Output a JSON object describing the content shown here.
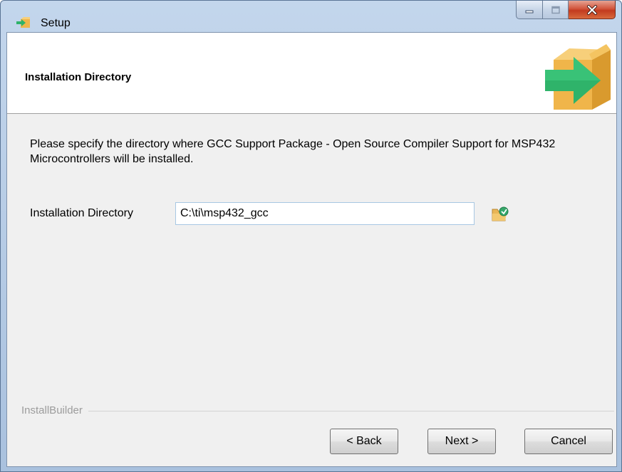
{
  "window": {
    "title": "Setup",
    "controls": [
      "minimize-icon",
      "maximize-icon",
      "close-icon"
    ]
  },
  "header": {
    "title": "Installation Directory",
    "logo_icon": "installer-box-arrow-icon"
  },
  "body": {
    "description": "Please specify the directory where GCC Support Package - Open Source Compiler Support for MSP432 Microcontrollers  will be installed.",
    "field_label": "Installation Directory",
    "field_value": "C:\\ti\\msp432_gcc",
    "browse_icon": "folder-browse-icon"
  },
  "footer": {
    "branding": "InstallBuilder",
    "back_label": "< Back",
    "next_label": "Next >",
    "cancel_label": "Cancel"
  },
  "colors": {
    "logo_green": "#2fb36a",
    "logo_box": "#f0b54a",
    "close_red": "#c9452a"
  }
}
